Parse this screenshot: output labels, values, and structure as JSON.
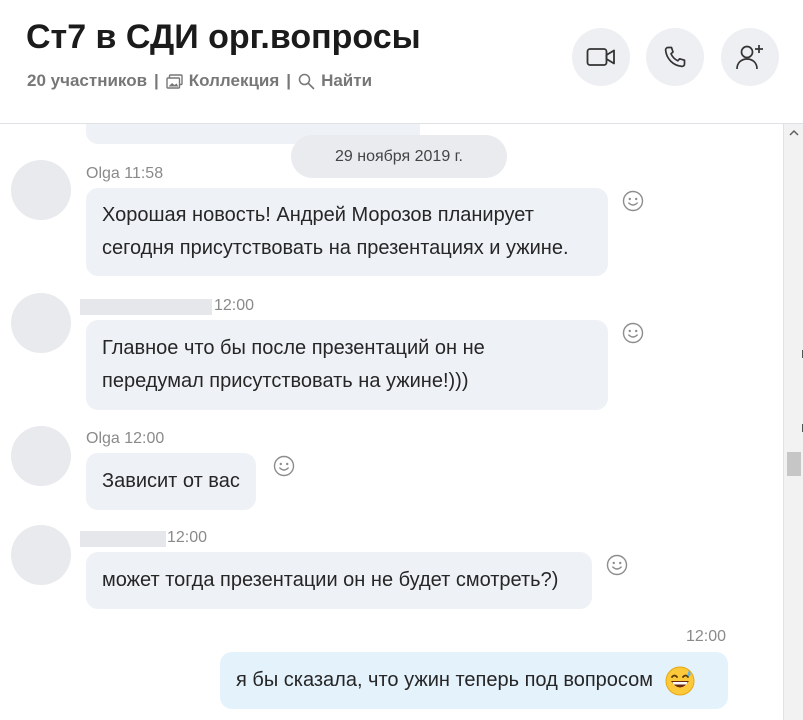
{
  "header": {
    "title": "Ст7 в СДИ орг.вопросы",
    "participants": "20 участников",
    "separator": "|",
    "collection": "Коллекция",
    "find": "Найти"
  },
  "toolbar": {
    "video_icon": "video-camera-icon",
    "call_icon": "phone-icon",
    "add_icon": "add-person-icon"
  },
  "chat": {
    "date_divider": "29 ноября 2019 г.",
    "messages": [
      {
        "sender": "Olga",
        "time": "11:58",
        "text": "Хорошая новость! Андрей Морозов планирует сегодня присутствовать на презентациях и ужине."
      },
      {
        "sender": "",
        "time": "12:00",
        "text": "Главное что бы после презентаций он не передумал присутствовать на ужине!)))"
      },
      {
        "sender": "Olga",
        "time": "12:00",
        "text": "Зависит от вас"
      },
      {
        "sender": "",
        "time": "12:00",
        "text": "может тогда презентации он не будет смотреть?)"
      },
      {
        "sender": "",
        "time": "12:00",
        "text": "я бы сказала, что ужин теперь под вопросом",
        "emoji": "grinning-sweat-emoji"
      }
    ]
  },
  "colors": {
    "incoming_bubble": "#eef1f6",
    "outgoing_bubble": "#e4f2fc",
    "meta_text": "#8a8a8a"
  }
}
